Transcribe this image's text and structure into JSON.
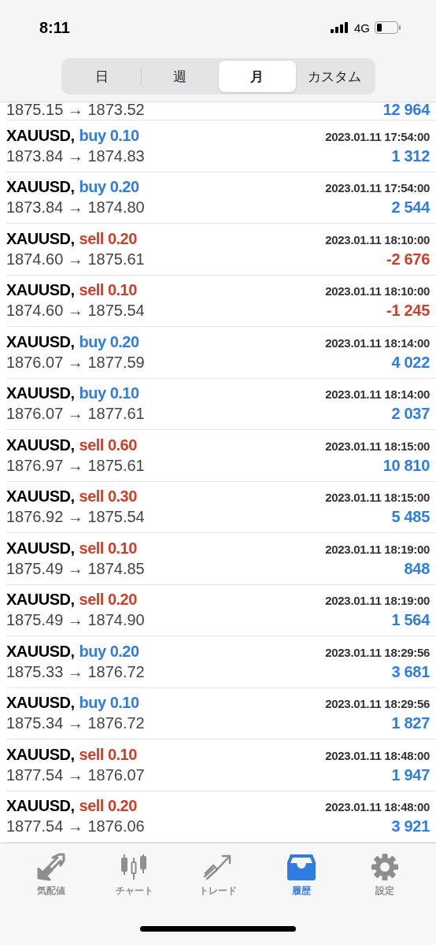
{
  "status_bar": {
    "time": "8:11",
    "network": "4G"
  },
  "period_tabs": [
    {
      "label": "日",
      "selected": false
    },
    {
      "label": "週",
      "selected": false
    },
    {
      "label": "月",
      "selected": true
    },
    {
      "label": "カスタム",
      "selected": false
    }
  ],
  "partial_row": {
    "prices": "1875.15 → 1873.52",
    "profit": "12 964",
    "loss": false
  },
  "deals": [
    {
      "symbol": "XAUUSD,",
      "kind": "buy",
      "side": "buy 0.10",
      "time": "2023.01.11 17:54:00",
      "prices": "1873.84 → 1874.83",
      "profit": "1 312",
      "loss": false
    },
    {
      "symbol": "XAUUSD,",
      "kind": "buy",
      "side": "buy 0.20",
      "time": "2023.01.11 17:54:00",
      "prices": "1873.84 → 1874.80",
      "profit": "2 544",
      "loss": false
    },
    {
      "symbol": "XAUUSD,",
      "kind": "sell",
      "side": "sell 0.20",
      "time": "2023.01.11 18:10:00",
      "prices": "1874.60 → 1875.61",
      "profit": "-2 676",
      "loss": true
    },
    {
      "symbol": "XAUUSD,",
      "kind": "sell",
      "side": "sell 0.10",
      "time": "2023.01.11 18:10:00",
      "prices": "1874.60 → 1875.54",
      "profit": "-1 245",
      "loss": true
    },
    {
      "symbol": "XAUUSD,",
      "kind": "buy",
      "side": "buy 0.20",
      "time": "2023.01.11 18:14:00",
      "prices": "1876.07 → 1877.59",
      "profit": "4 022",
      "loss": false
    },
    {
      "symbol": "XAUUSD,",
      "kind": "buy",
      "side": "buy 0.10",
      "time": "2023.01.11 18:14:00",
      "prices": "1876.07 → 1877.61",
      "profit": "2 037",
      "loss": false
    },
    {
      "symbol": "XAUUSD,",
      "kind": "sell",
      "side": "sell 0.60",
      "time": "2023.01.11 18:15:00",
      "prices": "1876.97 → 1875.61",
      "profit": "10 810",
      "loss": false
    },
    {
      "symbol": "XAUUSD,",
      "kind": "sell",
      "side": "sell 0.30",
      "time": "2023.01.11 18:15:00",
      "prices": "1876.92 → 1875.54",
      "profit": "5 485",
      "loss": false
    },
    {
      "symbol": "XAUUSD,",
      "kind": "sell",
      "side": "sell 0.10",
      "time": "2023.01.11 18:19:00",
      "prices": "1875.49 → 1874.85",
      "profit": "848",
      "loss": false
    },
    {
      "symbol": "XAUUSD,",
      "kind": "sell",
      "side": "sell 0.20",
      "time": "2023.01.11 18:19:00",
      "prices": "1875.49 → 1874.90",
      "profit": "1 564",
      "loss": false
    },
    {
      "symbol": "XAUUSD,",
      "kind": "buy",
      "side": "buy 0.20",
      "time": "2023.01.11 18:29:56",
      "prices": "1875.33 → 1876.72",
      "profit": "3 681",
      "loss": false
    },
    {
      "symbol": "XAUUSD,",
      "kind": "buy",
      "side": "buy 0.10",
      "time": "2023.01.11 18:29:56",
      "prices": "1875.34 → 1876.72",
      "profit": "1 827",
      "loss": false
    },
    {
      "symbol": "XAUUSD,",
      "kind": "sell",
      "side": "sell 0.10",
      "time": "2023.01.11 18:48:00",
      "prices": "1877.54 → 1876.07",
      "profit": "1 947",
      "loss": false
    },
    {
      "symbol": "XAUUSD,",
      "kind": "sell",
      "side": "sell 0.20",
      "time": "2023.01.11 18:48:00",
      "prices": "1877.54 → 1876.06",
      "profit": "3 921",
      "loss": false
    }
  ],
  "tab_bar": [
    {
      "kind": "quotes",
      "label": "気配値",
      "selected": false
    },
    {
      "kind": "chart",
      "label": "チャート",
      "selected": false
    },
    {
      "kind": "trade",
      "label": "トレード",
      "selected": false
    },
    {
      "kind": "history",
      "label": "履歴",
      "selected": true
    },
    {
      "kind": "settings",
      "label": "設定",
      "selected": false
    }
  ]
}
